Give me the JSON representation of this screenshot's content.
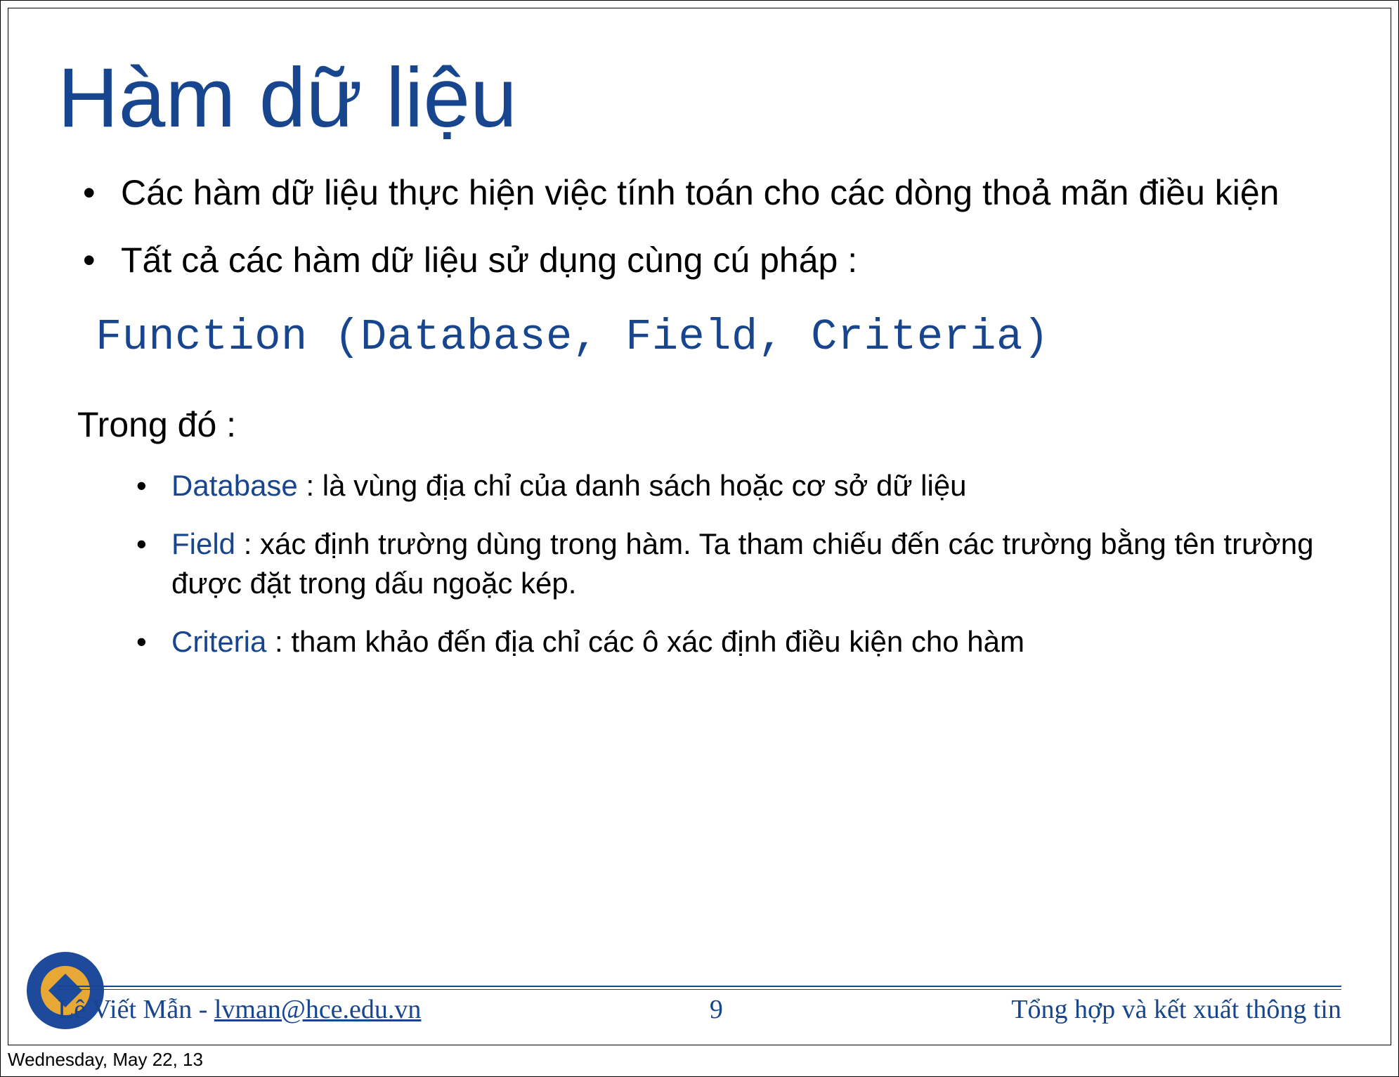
{
  "title": "Hàm dữ liệu",
  "bullets": {
    "b1": "Các hàm dữ liệu thực hiện việc tính toán cho các dòng thoả mãn điều kiện",
    "b2": "Tất cả các hàm dữ liệu sử dụng cùng cú pháp :"
  },
  "code_line": "Function (Database, Field, Criteria)",
  "trongdo": "Trong đó :",
  "params": {
    "p1_kw": "Database",
    "p1_txt": " : là vùng địa chỉ của danh sách hoặc cơ sở dữ liệu",
    "p2_kw": "Field",
    "p2_txt": " : xác định trường dùng trong hàm. Ta tham chiếu đến các trường bằng tên trường được đặt trong dấu ngoặc kép.",
    "p3_kw": "Criteria",
    "p3_txt": " : tham khảo đến địa chỉ các ô xác định điều kiện cho hàm"
  },
  "footer": {
    "author_name": "Lê Viết Mẫn - ",
    "author_email": "lvman@hce.edu.vn",
    "page": "9",
    "subject": "Tổng hợp và kết xuất thông tin"
  },
  "date": "Wednesday, May 22, 13"
}
